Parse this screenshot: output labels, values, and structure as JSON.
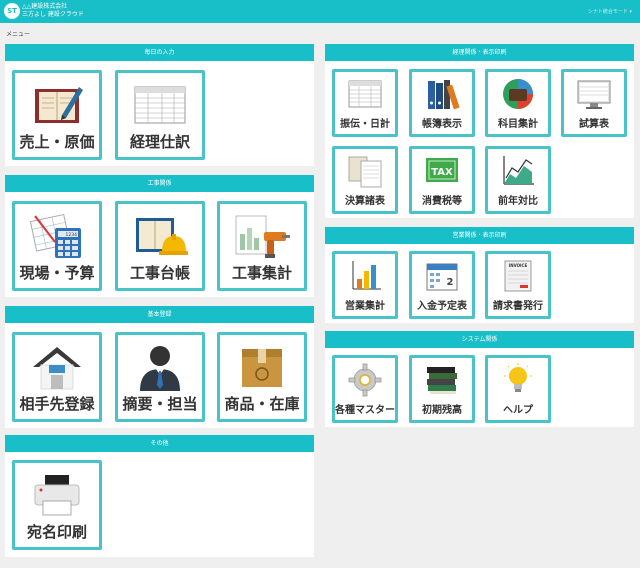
{
  "header": {
    "logo_text": "ST",
    "company_line1": "△△建設株式会社",
    "company_line2": "三方よし 建設クラウド",
    "right_text": "シナト統合モード ▾"
  },
  "menu_label": "メニュー",
  "panels": {
    "daily": {
      "title": "毎日の入力",
      "tiles": [
        "売上・原価",
        "経理仕訳"
      ]
    },
    "construction": {
      "title": "工事関係",
      "tiles": [
        "現場・予算",
        "工事台帳",
        "工事集計"
      ]
    },
    "master": {
      "title": "基本登録",
      "tiles": [
        "相手先登録",
        "摘要・担当",
        "商品・在庫"
      ]
    },
    "other": {
      "title": "その他",
      "tiles": [
        "宛名印刷"
      ]
    },
    "accounting": {
      "title": "経理関係・表示印刷",
      "tiles": [
        "振伝・日計",
        "帳簿表示",
        "科目集計",
        "試算表",
        "決算諸表",
        "消費税等",
        "前年対比"
      ]
    },
    "sales": {
      "title": "営業関係・表示印刷",
      "tiles": [
        "営業集計",
        "入金予定表",
        "請求書発行"
      ]
    },
    "system": {
      "title": "システム関係",
      "tiles": [
        "各種マスター",
        "初期残高",
        "ヘルプ"
      ]
    }
  },
  "icon_text": {
    "tax": "TAX",
    "invoice": "INVOICE",
    "calendar_day": "2",
    "calc_display": "1234"
  }
}
